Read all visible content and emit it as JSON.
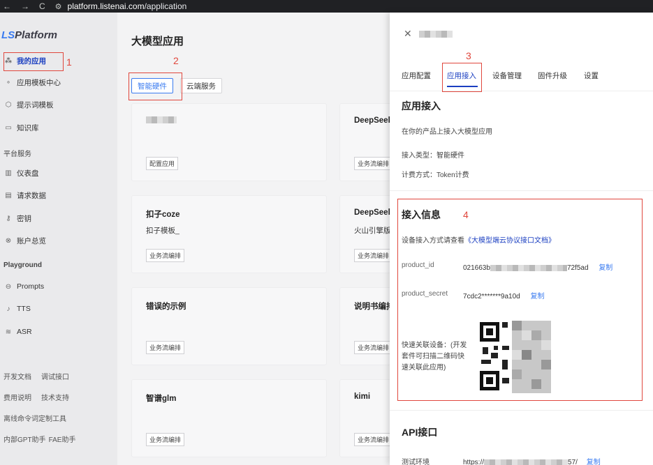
{
  "browser": {
    "url_host": "platform.listenai.com",
    "url_path": "/application",
    "nav": [
      "←",
      "→",
      "C"
    ]
  },
  "sidebar": {
    "logo_prefix": "LS",
    "logo_rest": "Platform",
    "items": [
      {
        "label": "我的应用",
        "icon": "grid-icon"
      },
      {
        "label": "应用模板中心",
        "icon": "nodes-icon"
      },
      {
        "label": "提示词模板",
        "icon": "cube-icon"
      },
      {
        "label": "知识库",
        "icon": "book-icon"
      }
    ],
    "section_platform": "平台服务",
    "platform_items": [
      {
        "label": "仪表盘",
        "icon": "bar-chart-icon"
      },
      {
        "label": "请求数据",
        "icon": "document-icon"
      },
      {
        "label": "密钥",
        "icon": "key-icon"
      },
      {
        "label": "账户总览",
        "icon": "account-icon"
      }
    ],
    "section_playground": "Playground",
    "playground_items": [
      {
        "label": "Prompts",
        "icon": "chat-icon"
      },
      {
        "label": "TTS",
        "icon": "mic-icon"
      },
      {
        "label": "ASR",
        "icon": "wave-icon"
      }
    ],
    "footer": [
      [
        "开发文档",
        "调试接口"
      ],
      [
        "费用说明",
        "技术支持"
      ],
      [
        "离线命令词定制工具"
      ],
      [
        "内部GPT助手",
        "FAE助手"
      ]
    ]
  },
  "annotations": [
    "1",
    "2",
    "3",
    "4"
  ],
  "main": {
    "title": "大模型应用",
    "tabs": [
      "智能硬件",
      "云端服务"
    ],
    "cards": [
      {
        "title": "",
        "sub": "",
        "tag": "配置应用"
      },
      {
        "title": "DeepSeek",
        "sub": "",
        "tag": "业务流编排"
      },
      {
        "title": "扣子coze",
        "sub": "扣子模板_",
        "tag": "业务流编排"
      },
      {
        "title": "DeepSeek",
        "sub": "火山引擎版",
        "tag": "业务流编排"
      },
      {
        "title": "错误的示例",
        "sub": "",
        "tag": "业务流编排"
      },
      {
        "title": "说明书编排",
        "sub": "",
        "tag": "业务流编排"
      },
      {
        "title": "智谱glm",
        "sub": "",
        "tag": "业务流编排"
      },
      {
        "title": "kimi",
        "sub": "",
        "tag": "业务流编排"
      }
    ]
  },
  "drawer": {
    "tabs": [
      "应用配置",
      "应用接入",
      "设备管理",
      "固件升级",
      "设置"
    ],
    "section_title": "应用接入",
    "desc": "在你的产品上接入大模型应用",
    "access_type": "接入类型：智能硬件",
    "billing": "计费方式：Token计费",
    "info_title": "接入信息",
    "doc_prefix": "设备接入方式请查看",
    "doc_link": "《大模型端云协议接口文档》",
    "product_id_label": "product_id",
    "product_id_start": "021663b",
    "product_id_end": "72f5ad",
    "product_secret_label": "product_secret",
    "product_secret_value": "7cdc2*******9a10d",
    "copy_label": "复制",
    "quick_link_label": "快速关联设备：(开发套件可扫描二维码快速关联此应用)",
    "api_title": "API接口",
    "test_env_label": "测试环境",
    "test_env_start": "https://",
    "test_env_end": "57/"
  }
}
